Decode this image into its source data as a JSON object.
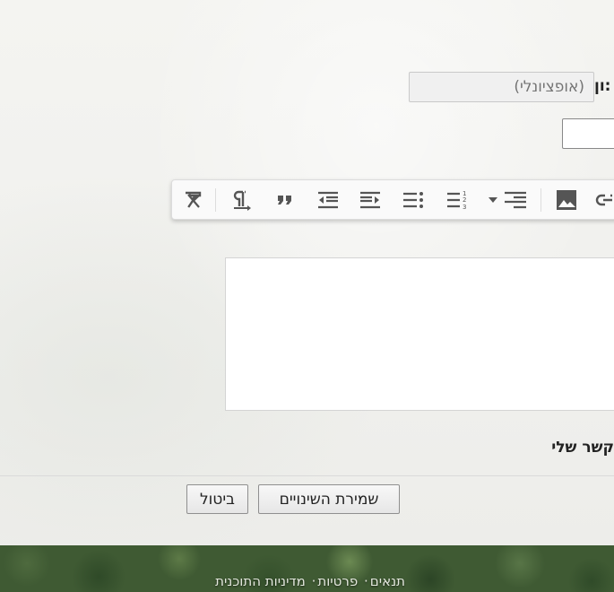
{
  "form": {
    "subject_label": "ון:",
    "subject_placeholder": "(אופציונלי)",
    "contact_label": "קשר שלי"
  },
  "toolbar": {
    "buttons": [
      "clear-formatting",
      "paragraph-direction",
      "blockquote",
      "outdent",
      "indent",
      "bulleted-list",
      "numbered-list",
      "align-dropdown",
      "image",
      "link"
    ]
  },
  "actions": {
    "save_label": "שמירת השינויים",
    "cancel_label": "ביטול"
  },
  "footer": {
    "terms": "תנאים",
    "sep1": "·",
    "privacy": "פרטיות",
    "sep2": "·",
    "policy": "מדיניות התוכנית"
  },
  "colors": {
    "icon": "#555555",
    "page_bg": "#f2f2ef",
    "footer_bg": "#3f5a33"
  }
}
